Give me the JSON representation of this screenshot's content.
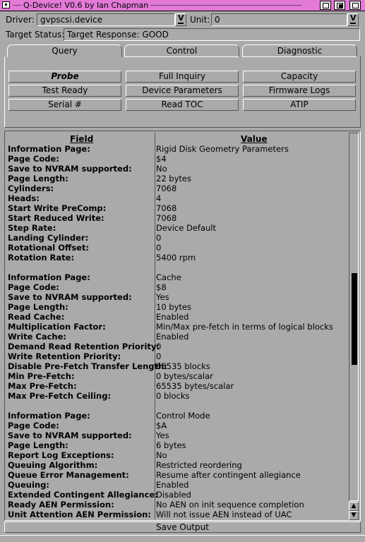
{
  "window": {
    "title": "Q-Device! V0.6 by Ian Chapman"
  },
  "driver": {
    "label": "Driver:",
    "value": "gvpscsi.device"
  },
  "unit": {
    "label": "Unit:",
    "value": "0"
  },
  "target_status": {
    "label": "Target Status:",
    "value": "Target Response: GOOD"
  },
  "tabs": [
    {
      "label": "Query"
    },
    {
      "label": "Control"
    },
    {
      "label": "Diagnostic"
    }
  ],
  "buttons": [
    {
      "label": "Probe"
    },
    {
      "label": "Full Inquiry"
    },
    {
      "label": "Capacity"
    },
    {
      "label": "Test Ready"
    },
    {
      "label": "Device Parameters"
    },
    {
      "label": "Firmware Logs"
    },
    {
      "label": "Serial #"
    },
    {
      "label": "Read TOC"
    },
    {
      "label": "ATIP"
    }
  ],
  "table": {
    "headers": {
      "field": "Field",
      "value": "Value"
    },
    "rows": [
      {
        "field": "Information Page:",
        "value": "Rigid Disk Geometry Parameters"
      },
      {
        "field": "Page Code:",
        "value": "$4"
      },
      {
        "field": "Save to NVRAM supported:",
        "value": "No"
      },
      {
        "field": "Page Length:",
        "value": "22 bytes"
      },
      {
        "field": "Cylinders:",
        "value": "7068"
      },
      {
        "field": "Heads:",
        "value": "4"
      },
      {
        "field": "Start Write PreComp:",
        "value": "7068"
      },
      {
        "field": "Start Reduced Write:",
        "value": "7068"
      },
      {
        "field": "Step Rate:",
        "value": "Device Default"
      },
      {
        "field": "Landing Cylinder:",
        "value": "0"
      },
      {
        "field": "Rotational Offset:",
        "value": "0"
      },
      {
        "field": "Rotation Rate:",
        "value": "5400 rpm"
      },
      {
        "field": "",
        "value": ""
      },
      {
        "field": "Information Page:",
        "value": "Cache"
      },
      {
        "field": "Page Code:",
        "value": "$8"
      },
      {
        "field": "Save to NVRAM supported:",
        "value": "Yes"
      },
      {
        "field": "Page Length:",
        "value": "10 bytes"
      },
      {
        "field": "Read Cache:",
        "value": "Enabled"
      },
      {
        "field": "Multiplication Factor:",
        "value": "Min/Max pre-fetch in terms of logical blocks"
      },
      {
        "field": "Write Cache:",
        "value": "Enabled"
      },
      {
        "field": "Demand Read Retention Priority:",
        "value": "0"
      },
      {
        "field": "Write Retention Priority:",
        "value": "0"
      },
      {
        "field": "Disable Pre-Fetch Transfer Length:",
        "value": "65535 blocks"
      },
      {
        "field": "Min Pre-Fetch:",
        "value": "0 bytes/scalar"
      },
      {
        "field": "Max Pre-Fetch:",
        "value": "65535 bytes/scalar"
      },
      {
        "field": "Max Pre-Fetch Ceiling:",
        "value": "0 blocks"
      },
      {
        "field": "",
        "value": ""
      },
      {
        "field": "Information Page:",
        "value": "Control Mode"
      },
      {
        "field": "Page Code:",
        "value": "$A"
      },
      {
        "field": "Save to NVRAM supported:",
        "value": "Yes"
      },
      {
        "field": "Page Length:",
        "value": "6 bytes"
      },
      {
        "field": "Report Log Exceptions:",
        "value": "No"
      },
      {
        "field": "Queuing Algorithm:",
        "value": "Restricted reordering"
      },
      {
        "field": "Queue Error Management:",
        "value": "Resume after contingent allegiance"
      },
      {
        "field": "Queuing:",
        "value": "Enabled"
      },
      {
        "field": "Extended Contingent Allegiance:",
        "value": "Disabled"
      },
      {
        "field": "Ready AEN Permission:",
        "value": "No AEN on init sequence completion"
      },
      {
        "field": "Unit Attention AEN Permission:",
        "value": "Will not issue AEN instead of UAC"
      }
    ]
  },
  "footer": {
    "save_label": "Save Output"
  },
  "colors": {
    "titlebar": "#e27ad6",
    "background": "#aaaaaa"
  }
}
